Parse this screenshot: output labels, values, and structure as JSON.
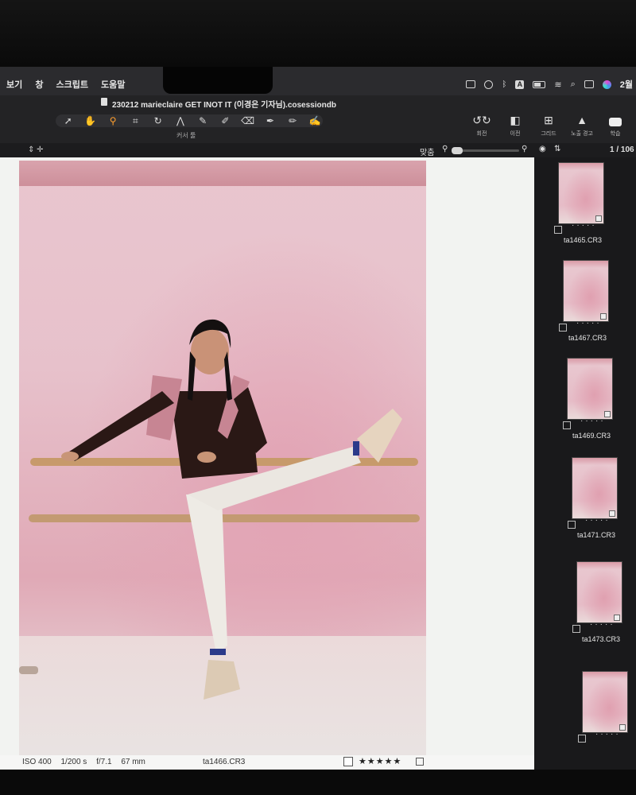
{
  "menubar": {
    "items": [
      "보기",
      "창",
      "스크립트",
      "도움말"
    ],
    "clock": "2월"
  },
  "window": {
    "title": "230212 marieclaire GET INOT IT (이경은 기자님).cosessiondb"
  },
  "toolbar": {
    "cursor_tools_label": "커서 툴",
    "right_tools": [
      {
        "icon": "rotate-icon",
        "label": "회전"
      },
      {
        "icon": "compare-icon",
        "label": "이전"
      },
      {
        "icon": "grid-icon",
        "label": "그리드"
      },
      {
        "icon": "warning-icon",
        "label": "노출 경고"
      },
      {
        "icon": "play-icon",
        "label": "학습"
      }
    ]
  },
  "viewer": {
    "fit_label": "맞춤",
    "count": "1 / 106"
  },
  "photo_meta": {
    "iso": "ISO 400",
    "shutter": "1/200 s",
    "aperture": "f/7.1",
    "focal": "67 mm",
    "filename": "ta1466.CR3",
    "stars": "★★★★★"
  },
  "filmstrip": {
    "thumbs": [
      {
        "name": "ta1465.CR3"
      },
      {
        "name": "ta1467.CR3"
      },
      {
        "name": "ta1469.CR3"
      },
      {
        "name": "ta1471.CR3"
      },
      {
        "name": "ta1473.CR3"
      },
      {
        "name": ""
      }
    ]
  }
}
